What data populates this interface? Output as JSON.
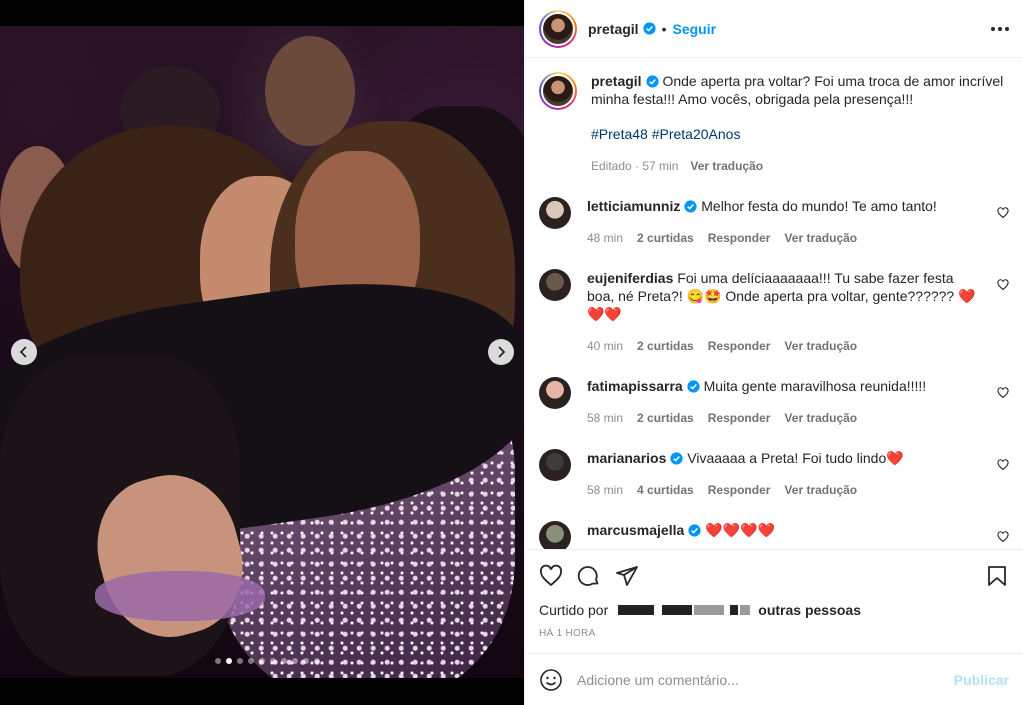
{
  "post": {
    "author": "pretagil",
    "follow_label": "Seguir",
    "separator": "•"
  },
  "caption": {
    "author": "pretagil",
    "text": "Onde aperta pra voltar? Foi uma troca de amor incrível minha festa!!! Amo vocês, obrigada pela presença!!!",
    "hashtags": "#Preta48 #Preta20Anos",
    "edited": "Editado · 57 min",
    "translate": "Ver tradução"
  },
  "comments": [
    {
      "user": "letticiamunniz",
      "verified": true,
      "text": "Melhor festa do mundo! Te amo tanto!",
      "time": "48 min",
      "likes": "2 curtidas",
      "reply": "Responder",
      "translate": "Ver tradução"
    },
    {
      "user": "eujeniferdias",
      "verified": false,
      "text": "Foi uma delíciaaaaaaa!!! Tu sabe fazer festa boa, né Preta?! 😋🤩 Onde aperta pra voltar, gente?????? ❤️❤️❤️",
      "time": "40 min",
      "likes": "2 curtidas",
      "reply": "Responder",
      "translate": "Ver tradução"
    },
    {
      "user": "fatimapissarra",
      "verified": true,
      "text": "Muita gente maravilhosa reunida!!!!!",
      "time": "58 min",
      "likes": "2 curtidas",
      "reply": "Responder",
      "translate": "Ver tradução"
    },
    {
      "user": "marianarios",
      "verified": true,
      "text": "Vivaaaaa a Preta! Foi tudo lindo❤️",
      "time": "58 min",
      "likes": "4 curtidas",
      "reply": "Responder",
      "translate": "Ver tradução"
    },
    {
      "user": "marcusmajella",
      "verified": true,
      "text": "❤️❤️❤️❤️",
      "time": "",
      "likes": "",
      "reply": "",
      "translate": ""
    }
  ],
  "likes": {
    "prefix": "Curtido por",
    "suffix": "outras pessoas"
  },
  "timestamp": "HÁ 1 HORA",
  "add_comment": {
    "placeholder": "Adicione um comentário...",
    "publish": "Publicar"
  },
  "carousel": {
    "total": 10,
    "active_index": 1
  },
  "colors": {
    "accent": "#0095f6",
    "link": "#00376b",
    "muted": "#8e8e8e",
    "publish_disabled": "#b2dffc"
  }
}
